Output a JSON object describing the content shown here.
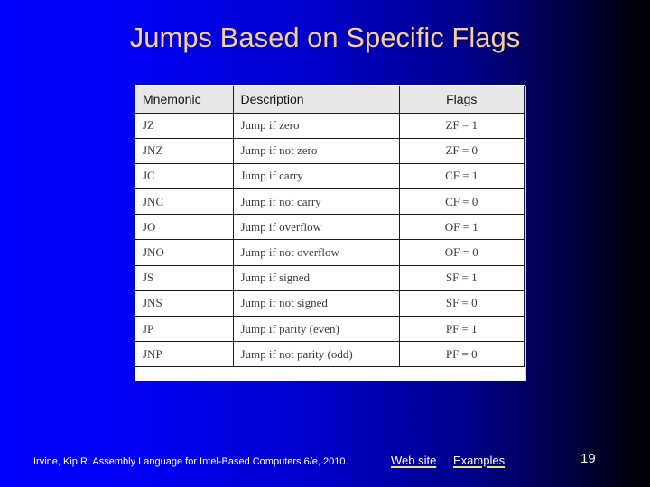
{
  "slide": {
    "title": "Jumps Based on Specific Flags",
    "page_number": "19",
    "background_colors": [
      "#0000ff",
      "#000000"
    ],
    "title_color": "#f6cfa0"
  },
  "table": {
    "headers": [
      "Mnemonic",
      "Description",
      "Flags"
    ],
    "rows": [
      {
        "mnemonic": "JZ",
        "description": "Jump if zero",
        "flags": "ZF = 1"
      },
      {
        "mnemonic": "JNZ",
        "description": "Jump if not zero",
        "flags": "ZF = 0"
      },
      {
        "mnemonic": "JC",
        "description": "Jump if carry",
        "flags": "CF = 1"
      },
      {
        "mnemonic": "JNC",
        "description": "Jump if not carry",
        "flags": "CF = 0"
      },
      {
        "mnemonic": "JO",
        "description": "Jump if overflow",
        "flags": "OF = 1"
      },
      {
        "mnemonic": "JNO",
        "description": "Jump if not overflow",
        "flags": "OF = 0"
      },
      {
        "mnemonic": "JS",
        "description": "Jump if signed",
        "flags": "SF = 1"
      },
      {
        "mnemonic": "JNS",
        "description": "Jump if not signed",
        "flags": "SF = 0"
      },
      {
        "mnemonic": "JP",
        "description": "Jump if parity (even)",
        "flags": "PF = 1"
      },
      {
        "mnemonic": "JNP",
        "description": "Jump if not parity (odd)",
        "flags": "PF = 0"
      }
    ]
  },
  "footer": {
    "citation": "Irvine, Kip R. Assembly Language for Intel-Based Computers 6/e, 2010.",
    "links": [
      {
        "label": "Web site"
      },
      {
        "label": "Examples"
      }
    ]
  }
}
